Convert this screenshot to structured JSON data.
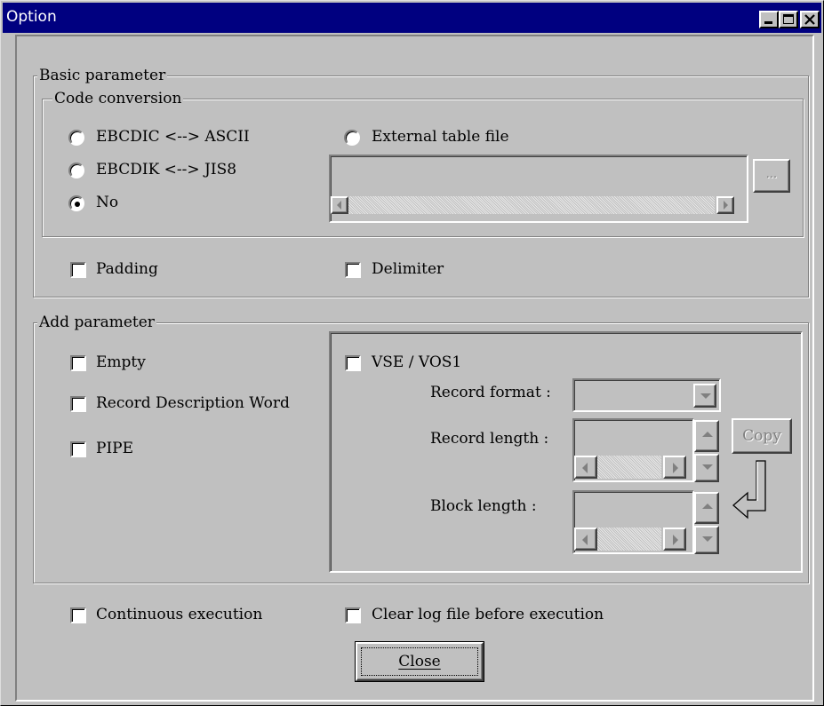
{
  "window": {
    "title": "Option"
  },
  "basic": {
    "group_label": "Basic parameter",
    "code_conversion": {
      "group_label": "Code conversion",
      "radios": [
        {
          "label": "EBCDIC <--> ASCII",
          "selected": false
        },
        {
          "label": "EBCDIK <--> JIS8",
          "selected": false
        },
        {
          "label": "No",
          "selected": true
        }
      ],
      "external": {
        "label": "External table file",
        "selected": false,
        "value": "",
        "browse_label": "..."
      }
    },
    "padding": {
      "label": "Padding",
      "checked": false
    },
    "delimiter": {
      "label": "Delimiter",
      "checked": false
    }
  },
  "add": {
    "group_label": "Add parameter",
    "empty": {
      "label": "Empty",
      "checked": false
    },
    "rdw": {
      "label": "Record Description Word",
      "checked": false
    },
    "pipe": {
      "label": "PIPE",
      "checked": false
    },
    "vse": {
      "label": "VSE / VOS1",
      "checked": false,
      "record_format_label": "Record format :",
      "record_format_value": "",
      "record_length_label": "Record length :",
      "record_length_value": "",
      "block_length_label": "Block length :",
      "block_length_value": "",
      "copy_label": "Copy"
    }
  },
  "continuous": {
    "label": "Continuous execution",
    "checked": false
  },
  "clear_log": {
    "label": "Clear log file before execution",
    "checked": false
  },
  "close_label": "Close",
  "colors": {
    "titlebar": "#000080",
    "face": "#c0c0c0"
  }
}
